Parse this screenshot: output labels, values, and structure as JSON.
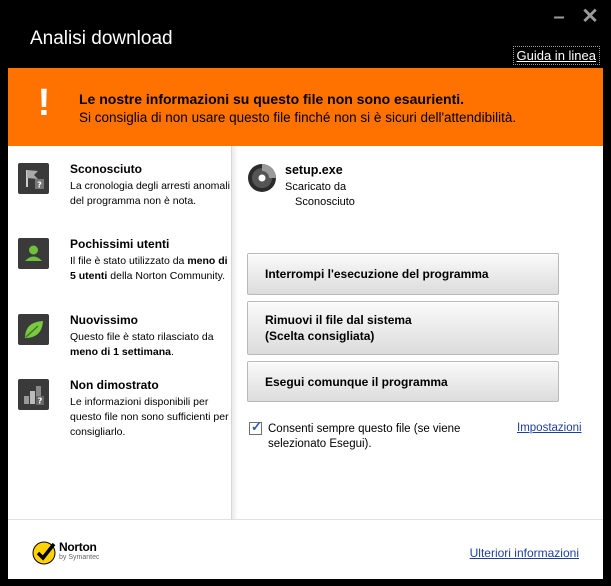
{
  "window": {
    "title": "Analisi download",
    "minimize_label": "–",
    "close_label": "✕",
    "help_link": "Guida in linea"
  },
  "banner": {
    "title": "Le nostre informazioni su questo file non sono esaurienti.",
    "subtitle": "Si consiglia di non usare questo file finché non si è sicuri dell'attendibilità.",
    "icon": "warning-exclamation-icon",
    "color": "#ff7200"
  },
  "info": [
    {
      "title": "Sconosciuto",
      "icon": "unknown-flag-icon",
      "desc_parts": [
        "La cronologia degli arresti anomali del programma non è nota."
      ]
    },
    {
      "title": "Pochissimi utenti",
      "icon": "user-icon",
      "desc_parts": [
        "Il file è stato utilizzato da ",
        "meno di 5 utenti",
        " della Norton Community."
      ]
    },
    {
      "title": "Nuovissimo",
      "icon": "leaf-icon",
      "desc_parts": [
        "Questo file è stato rilasciato da ",
        "meno di 1 settimana",
        "."
      ]
    },
    {
      "title": "Non dimostrato",
      "icon": "unproven-chart-icon",
      "desc_parts": [
        "Le informazioni disponibili per questo file non sono sufficienti per consigliarlo."
      ]
    }
  ],
  "file": {
    "name": "setup.exe",
    "downloaded_from_label": "Scaricato da",
    "source": "Sconosciuto",
    "icon": "disc-icon"
  },
  "actions": {
    "stop": "Interrompi l'esecuzione del programma",
    "remove_line1": "Rimuovi il file dal sistema",
    "remove_line2": "(Scelta consigliata)",
    "run_anyway": "Esegui comunque il programma"
  },
  "always_allow": {
    "checked": true,
    "label": "Consenti sempre questo file (se viene selezionato Esegui).",
    "settings_link": "Impostazioni"
  },
  "footer": {
    "brand": "Norton",
    "brand_sub": "by Symantec",
    "more_info": "Ulteriori informazioni"
  }
}
